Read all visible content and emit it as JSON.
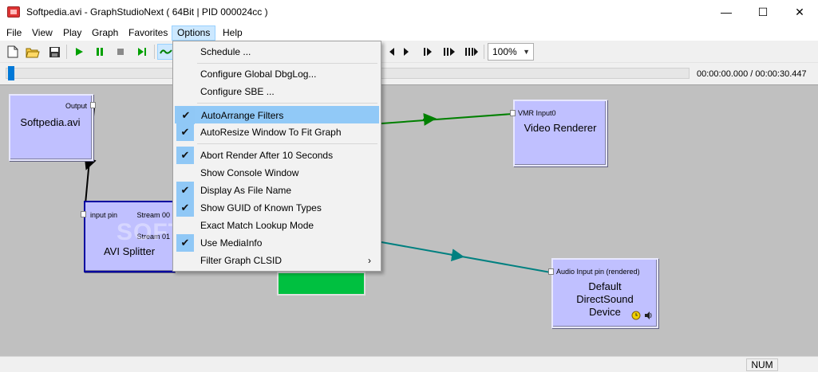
{
  "window": {
    "title": "Softpedia.avi - GraphStudioNext ( 64Bit | PID 000024cc )",
    "min_glyph": "—",
    "max_glyph": "☐",
    "close_glyph": "✕"
  },
  "menubar": {
    "items": [
      "File",
      "View",
      "Play",
      "Graph",
      "Favorites",
      "Options",
      "Help"
    ]
  },
  "toolbar": {
    "zoom": "100%"
  },
  "seek": {
    "time": "00:00:00.000 / 00:00:30.447",
    "progress": 0.0
  },
  "graph": {
    "source": {
      "name": "Softpedia.avi",
      "pin_out": "Output"
    },
    "splitter": {
      "name": "AVI Splitter",
      "pin_in": "input pin",
      "pin_out1": "Stream 00",
      "pin_out2": "Stream 01"
    },
    "video_renderer": {
      "name": "Video Renderer",
      "pin_in": "VMR Input0"
    },
    "audio_renderer": {
      "name_line1": "Default",
      "name_line2": "DirectSound",
      "name_line3": "Device",
      "pin_in": "Audio Input pin (rendered)"
    },
    "watermark": "SOFTPEDIA"
  },
  "options_menu": {
    "items": [
      {
        "label": "Schedule ...",
        "checked": false
      },
      {
        "label": "Configure Global DbgLog...",
        "checked": false
      },
      {
        "label": "Configure SBE ...",
        "checked": false
      },
      {
        "label": "AutoArrange Filters",
        "checked": true
      },
      {
        "label": "AutoResize Window To Fit Graph",
        "checked": true
      },
      {
        "label": "Abort Render After 10 Seconds",
        "checked": true
      },
      {
        "label": "Show Console Window",
        "checked": false
      },
      {
        "label": "Display As File Name",
        "checked": true
      },
      {
        "label": "Show GUID of Known Types",
        "checked": true
      },
      {
        "label": "Exact Match Lookup Mode",
        "checked": false
      },
      {
        "label": "Use MediaInfo",
        "checked": true
      },
      {
        "label": "Filter Graph CLSID",
        "checked": false
      }
    ],
    "check_glyph": "✔",
    "submenu_glyph": "›"
  },
  "status": {
    "num": "NUM"
  },
  "colors": {
    "filter_fill": "#c0c0ff",
    "canvas": "#c0c0c0",
    "video_link": "#008000",
    "audio_link": "#008080",
    "accent": "#0078d7"
  }
}
